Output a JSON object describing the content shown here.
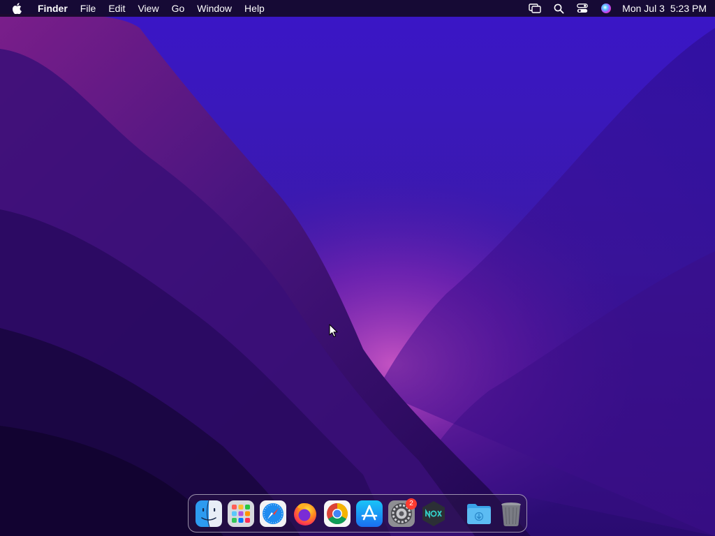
{
  "menubar": {
    "apple_icon": "apple-logo-icon",
    "app_name": "Finder",
    "menus": [
      "File",
      "Edit",
      "View",
      "Go",
      "Window",
      "Help"
    ],
    "status_icons": [
      "screen-mirroring-icon",
      "spotlight-search-icon",
      "control-center-icon",
      "siri-icon"
    ],
    "date": "Mon Jul 3",
    "time": "5:23 PM"
  },
  "dock": {
    "apps": [
      {
        "name": "Finder",
        "icon": "finder-icon"
      },
      {
        "name": "Launchpad",
        "icon": "launchpad-icon"
      },
      {
        "name": "Safari",
        "icon": "safari-icon"
      },
      {
        "name": "Firefox",
        "icon": "firefox-icon"
      },
      {
        "name": "Google Chrome",
        "icon": "chrome-icon"
      },
      {
        "name": "App Store",
        "icon": "app-store-icon"
      },
      {
        "name": "System Preferences",
        "icon": "system-preferences-icon",
        "badge": "2"
      },
      {
        "name": "Nox",
        "icon": "nox-icon"
      }
    ],
    "folders": [
      {
        "name": "Downloads",
        "icon": "downloads-folder-icon"
      },
      {
        "name": "Trash",
        "icon": "trash-icon"
      }
    ]
  },
  "colors": {
    "wallpaper_base": "#2a0a6a",
    "wallpaper_glow": "#c23dbe",
    "badge": "#ff3b30"
  }
}
